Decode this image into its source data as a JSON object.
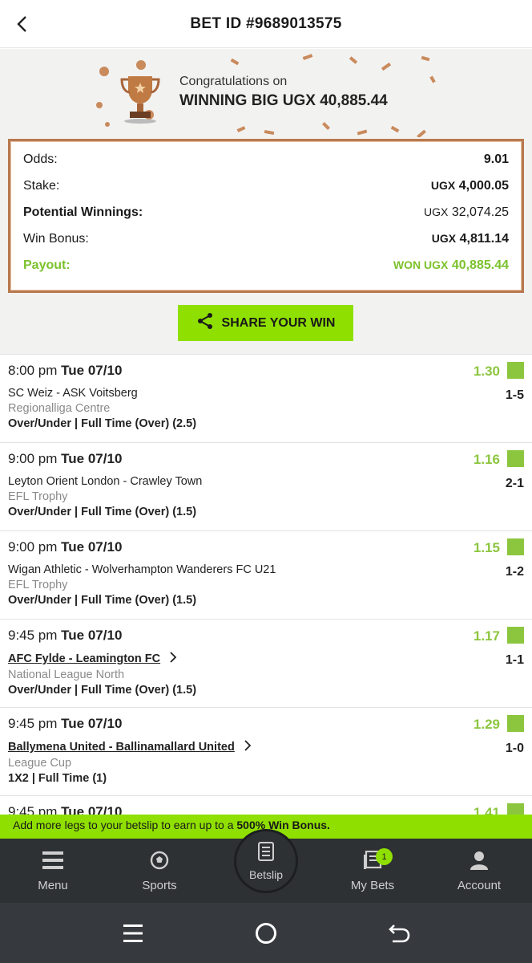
{
  "header": {
    "title": "BET ID #9689013575"
  },
  "banner": {
    "congrats": "Congratulations on",
    "win_big": "WINNING BIG UGX 40,885.44"
  },
  "details": {
    "odds_label": "Odds:",
    "odds_value": "9.01",
    "stake_label": "Stake:",
    "stake_currency": "UGX",
    "stake_value": "4,000.05",
    "potential_label": "Potential Winnings:",
    "potential_currency": "UGX",
    "potential_value": "32,074.25",
    "bonus_label": "Win Bonus:",
    "bonus_currency": "UGX",
    "bonus_value": "4,811.14",
    "payout_label": "Payout:",
    "payout_prefix": "WON UGX",
    "payout_value": "40,885.44"
  },
  "share_label": "SHARE YOUR WIN",
  "bets": [
    {
      "time": "8:00 pm",
      "date": "Tue 07/10",
      "odds": "1.30",
      "teams": "SC Weiz - ASK Voitsberg",
      "score": "1-5",
      "league": "Regionalliga Centre",
      "market": "Over/Under | Full Time (Over) (2.5)"
    },
    {
      "time": "9:00 pm",
      "date": "Tue 07/10",
      "odds": "1.16",
      "teams": "Leyton Orient London - Crawley Town",
      "score": "2-1",
      "league": "EFL Trophy",
      "market": "Over/Under | Full Time (Over) (1.5)"
    },
    {
      "time": "9:00 pm",
      "date": "Tue 07/10",
      "odds": "1.15",
      "teams": "Wigan Athletic - Wolverhampton Wanderers FC U21",
      "score": "1-2",
      "league": "EFL Trophy",
      "market": "Over/Under | Full Time (Over) (1.5)"
    },
    {
      "time": "9:45 pm",
      "date": "Tue 07/10",
      "odds": "1.17",
      "teams": "AFC Fylde - Leamington FC",
      "score": "1-1",
      "league": "National League North",
      "market": "Over/Under | Full Time (Over) (1.5)"
    },
    {
      "time": "9:45 pm",
      "date": "Tue 07/10",
      "odds": "1.29",
      "teams": "Ballymena United - Ballinamallard United",
      "score": "1-0",
      "league": "League Cup",
      "market": "1X2 | Full Time (1)"
    },
    {
      "time": "9:45 pm",
      "date": "Tue 07/10",
      "odds": "1.41"
    }
  ],
  "promo": {
    "text": "Add more legs to your betslip to earn up to a",
    "highlight": "500% Win Bonus."
  },
  "nav": {
    "menu": "Menu",
    "sports": "Sports",
    "betslip": "Betslip",
    "mybets": "My Bets",
    "mybets_badge": "1",
    "account": "Account"
  },
  "colors": {
    "accent": "#8fe000",
    "odds_green": "#8cc63f",
    "payout_green": "#7cc22c",
    "frame_copper": "#b8794f",
    "nav_bg": "#2e3134"
  },
  "icons": [
    "back-arrow-icon",
    "trophy-icon",
    "share-icon",
    "checkbox-won-icon",
    "chevron-right-icon",
    "menu-icon",
    "soccer-ball-icon",
    "betslip-icon",
    "my-bets-icon",
    "account-icon",
    "recents-icon",
    "home-icon",
    "back-icon"
  ]
}
